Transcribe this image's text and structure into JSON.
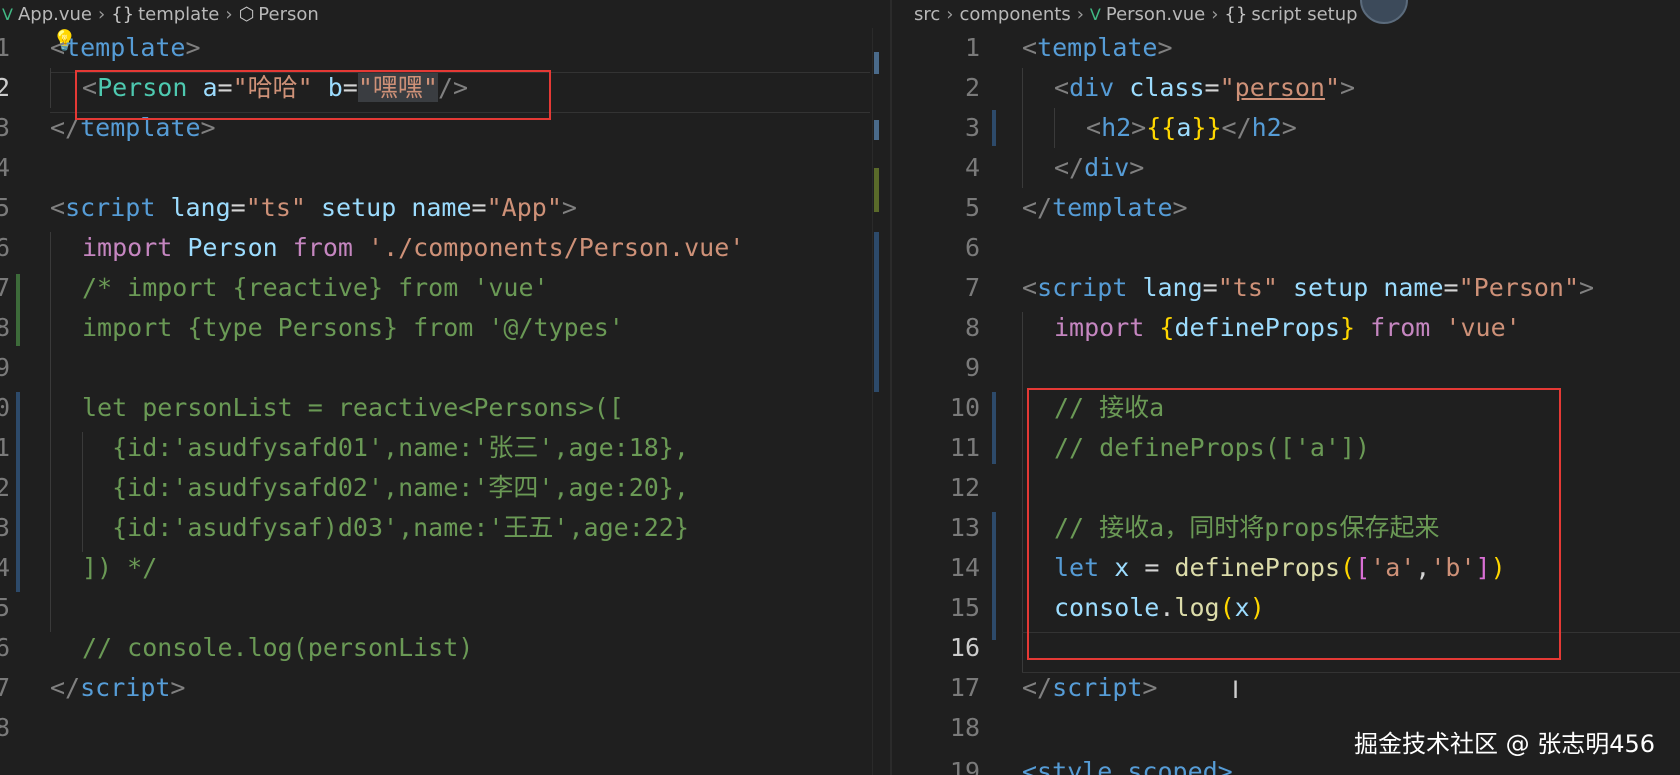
{
  "left_editor": {
    "breadcrumb": [
      {
        "label": "App.vue",
        "icon": "vue-icon"
      },
      {
        "label": "template",
        "icon": "braces-icon"
      },
      {
        "label": "Person",
        "icon": "cube-icon"
      }
    ],
    "line_numbers": [
      "1",
      "2",
      "3",
      "4",
      "5",
      "6",
      "7",
      "8",
      "9",
      "0",
      "1",
      "2",
      "3",
      "4",
      "5",
      "6",
      "7",
      "8"
    ],
    "lines": {
      "l1_tag": "template",
      "l2_component": "Person",
      "l2_attr_a": "a",
      "l2_val_a": "\"哈哈\"",
      "l2_attr_b": "b",
      "l2_val_b": "\"嘿嘿\"",
      "l3_tag": "template",
      "l5_tag": "script",
      "l5_attr_lang": "lang",
      "l5_val_lang": "\"ts\"",
      "l5_attr_setup": "setup",
      "l5_attr_name": "name",
      "l5_val_name": "\"App\"",
      "l6_import": "import",
      "l6_id": "Person",
      "l6_from": "from",
      "l6_path": "'./components/Person.vue'",
      "l7": "/* import {reactive} from 'vue'",
      "l8": "import {type Persons} from '@/types'",
      "l10": "let personList = reactive<Persons>([",
      "l11": "  {id:'asudfysafd01',name:'张三',age:18},",
      "l12": "  {id:'asudfysafd02',name:'李四',age:20},",
      "l13": "  {id:'asudfysaf)d03',name:'王五',age:22}",
      "l14": "]) */",
      "l16": "// console.log(personList)",
      "l17_tag": "script"
    }
  },
  "right_editor": {
    "breadcrumb": [
      {
        "label": "src",
        "icon": ""
      },
      {
        "label": "components",
        "icon": ""
      },
      {
        "label": "Person.vue",
        "icon": "vue-icon"
      },
      {
        "label": "script setup",
        "icon": "braces-icon"
      }
    ],
    "line_numbers": [
      "1",
      "2",
      "3",
      "4",
      "5",
      "6",
      "7",
      "8",
      "9",
      "10",
      "11",
      "12",
      "13",
      "14",
      "15",
      "16",
      "17",
      "18",
      "19"
    ],
    "lines": {
      "l1_tag": "template",
      "l2_tag": "div",
      "l2_attr": "class",
      "l2_val": "person",
      "l3_tag": "h2",
      "l3_expr": "a",
      "l4_tag": "div",
      "l5_tag": "template",
      "l7_tag": "script",
      "l7_attr_lang": "lang",
      "l7_val_lang": "\"ts\"",
      "l7_attr_setup": "setup",
      "l7_attr_name": "name",
      "l7_val_name": "\"Person\"",
      "l8_import": "import",
      "l8_id": "defineProps",
      "l8_from": "from",
      "l8_path": "'vue'",
      "l10": "// 接收a",
      "l11": "// defineProps(['a'])",
      "l13": "// 接收a，同时将props保存起来",
      "l14_let": "let",
      "l14_x": "x",
      "l14_eq": " = ",
      "l14_fn": "defineProps",
      "l14_a": "'a'",
      "l14_b": "'b'",
      "l15_console": "console",
      "l15_log": "log",
      "l15_x": "x",
      "l17_tag": "script",
      "l19_partial": "<style scoped>"
    }
  },
  "watermark": "掘金技术社区 @ 张志明456",
  "colors": {
    "background": "#1f1f1f",
    "highlight_box": "#e53935",
    "keyword": "#c586c0",
    "tag": "#569cd6",
    "string": "#ce9178",
    "comment": "#6a9955",
    "component": "#4ec9b0"
  }
}
